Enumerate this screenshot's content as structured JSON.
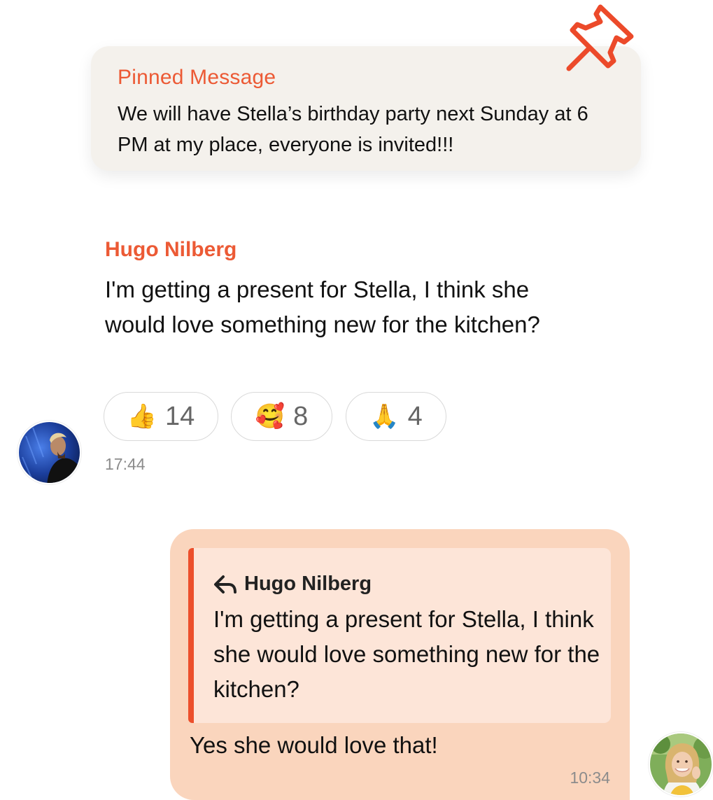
{
  "pinned": {
    "title": "Pinned Message",
    "text": "We will have Stella’s birthday party next Sunday at 6 PM at my place, everyone is invited!!!",
    "icon": "pin-icon"
  },
  "incoming": {
    "sender": "Hugo Nilberg",
    "text": "I'm getting a present for Stella, I think she would love something new for the kitchen?",
    "time": "17:44",
    "reactions": [
      {
        "emoji": "👍",
        "count": "14"
      },
      {
        "emoji": "🥰",
        "count": "8"
      },
      {
        "emoji": "🙏",
        "count": "4"
      }
    ]
  },
  "outgoing": {
    "reply_to": {
      "author": "Hugo Nilberg",
      "text": "I'm getting a present for Stella, I think she would love something new for the kitchen?"
    },
    "text": "Yes she would love that!",
    "time": "10:34"
  },
  "colors": {
    "accent": "#ec5a35",
    "pinned_bg": "#f4f1ec",
    "bubble_bg": "#fad5bd",
    "quote_bg": "#fde5d8"
  }
}
